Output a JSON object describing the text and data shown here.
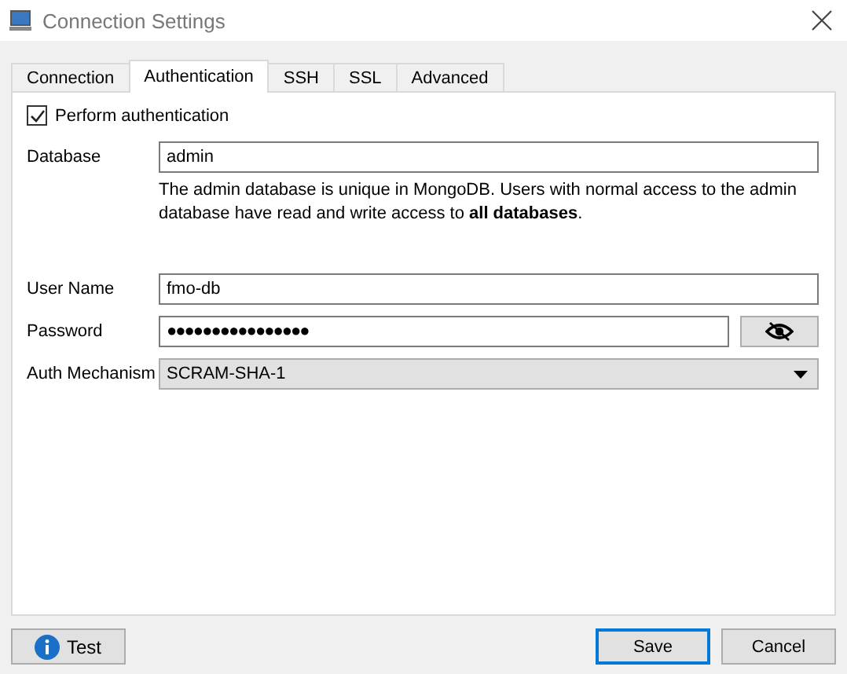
{
  "window": {
    "title": "Connection Settings"
  },
  "tabs": [
    {
      "label": "Connection",
      "selected": false
    },
    {
      "label": "Authentication",
      "selected": true
    },
    {
      "label": "SSH",
      "selected": false
    },
    {
      "label": "SSL",
      "selected": false
    },
    {
      "label": "Advanced",
      "selected": false
    }
  ],
  "perform_authentication": {
    "label": "Perform authentication",
    "checked": true
  },
  "fields": [
    {
      "kind": "text",
      "label": "Database",
      "value": "admin",
      "help": "The admin database is unique in MongoDB. Users with normal access to the admin database have read and write access to **all databases**."
    },
    {
      "kind": "text",
      "label": "User Name",
      "value": "fmo-db"
    },
    {
      "kind": "password",
      "label": "Password",
      "value": "●●●●●●●●●●●●●●●●"
    },
    {
      "kind": "select",
      "label": "Auth Mechanism",
      "value": "SCRAM-SHA-1"
    }
  ],
  "buttons": [
    {
      "kind": "test",
      "label": "Test"
    },
    {
      "kind": "default",
      "label": "Save"
    },
    {
      "kind": "normal",
      "label": "Cancel"
    }
  ]
}
